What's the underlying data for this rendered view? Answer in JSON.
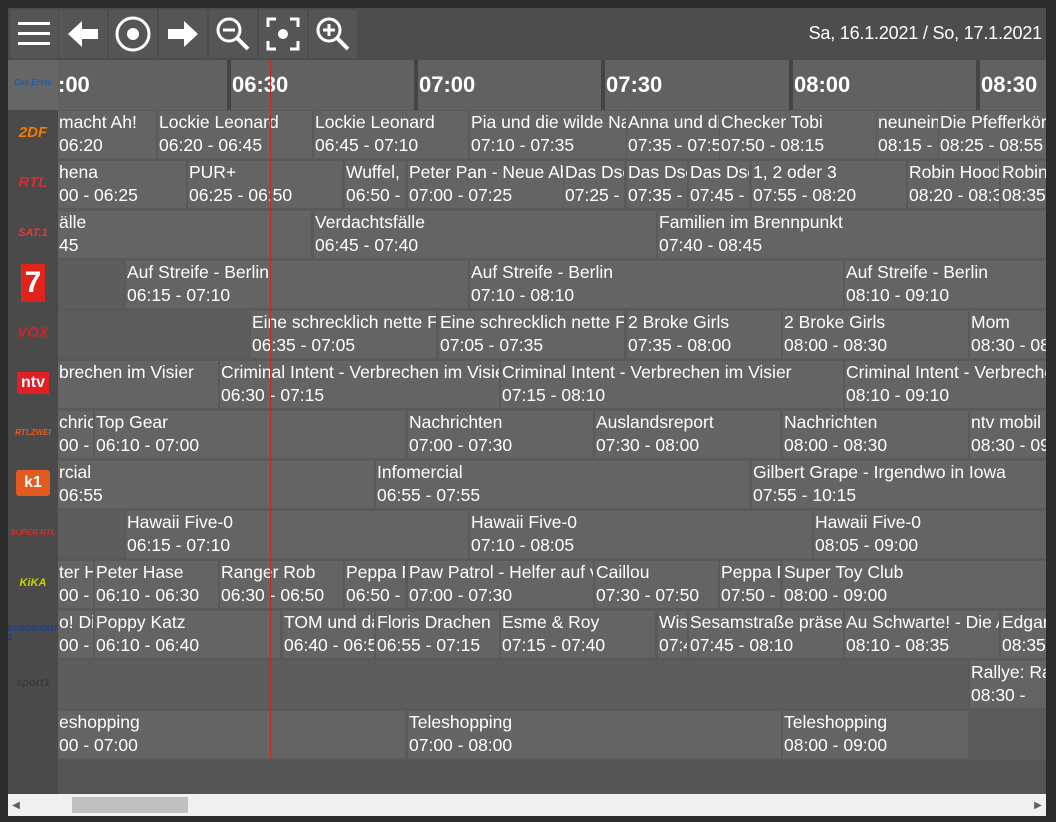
{
  "toolbar": {
    "menu_icon": "hamburger-icon",
    "back_icon": "arrow-left-icon",
    "now_icon": "target-icon",
    "forward_icon": "arrow-right-icon",
    "zoom_out_icon": "zoom-out-icon",
    "focus_icon": "focus-icon",
    "zoom_in_icon": "zoom-in-icon",
    "date_range": "Sa, 16.1.2021 / So, 17.1.2021"
  },
  "ruler": {
    "ticks": [
      ":00",
      "06:30",
      "07:00",
      "07:30",
      "08:00",
      "08:30"
    ]
  },
  "channels": [
    {
      "name": "Das Erste",
      "logo_text": "Das Erste",
      "color": "#1a5fa8",
      "programs": [
        {
          "title": " macht Ah!",
          "time": "06:20"
        },
        {
          "title": "Lockie Leonard",
          "time": "06:20 - 06:45"
        },
        {
          "title": "Lockie Leonard",
          "time": "06:45 - 07:10"
        },
        {
          "title": "Pia und die wilde Natur",
          "time": "07:10 - 07:35"
        },
        {
          "title": "Anna und die",
          "time": "07:35 - 07:50"
        },
        {
          "title": "Checker Tobi",
          "time": "07:50 - 08:15"
        },
        {
          "title": "neuneinhalb",
          "time": "08:15 - 08:25"
        },
        {
          "title": "Die Pfefferkörner",
          "time": "08:25 - 08:55"
        }
      ]
    },
    {
      "name": "ZDF",
      "logo_text": "2DF",
      "color": "#f07d00",
      "programs": [
        {
          "title": "hena",
          "time": "00 - 06:25"
        },
        {
          "title": "PUR+",
          "time": "06:25 - 06:50"
        },
        {
          "title": "Wuffel, d",
          "time": "06:50 - 07:00"
        },
        {
          "title": "Peter Pan - Neue Abenteuer",
          "time": "07:00 - 07:25"
        },
        {
          "title": "Das Dschungelbuch",
          "time": "07:25 - 07:35"
        },
        {
          "title": "Das Dschungelbuch",
          "time": "07:35 - 07:45"
        },
        {
          "title": "Das Dschungelbuch",
          "time": "07:45 - 07:55"
        },
        {
          "title": "1, 2 oder 3",
          "time": "07:55 - 08:20"
        },
        {
          "title": "Robin Hood",
          "time": "08:20 - 08:35"
        },
        {
          "title": "Robin Hood",
          "time": "08:35"
        }
      ]
    },
    {
      "name": "RTL",
      "logo_text": "RTL",
      "color": "#d32f2f",
      "programs": [
        {
          "title": "älle",
          "time": "45"
        },
        {
          "title": "Verdachtsfälle",
          "time": "06:45 - 07:40"
        },
        {
          "title": "Familien im Brennpunkt",
          "time": "07:40 - 08:45"
        }
      ]
    },
    {
      "name": "SAT.1",
      "logo_text": "SAT.1",
      "color": "#e53935",
      "programs": [
        {
          "title": "",
          "time": ""
        },
        {
          "title": "Auf Streife - Berlin",
          "time": "06:15 - 07:10"
        },
        {
          "title": "Auf Streife - Berlin",
          "time": "07:10 - 08:10"
        },
        {
          "title": "Auf Streife - Berlin",
          "time": "08:10 - 09:10"
        }
      ]
    },
    {
      "name": "ProSieben",
      "logo_text": "7",
      "color": "#e0241b",
      "programs": [
        {
          "title": "",
          "time": ""
        },
        {
          "title": "Eine schrecklich nette Familie",
          "time": "06:35 - 07:05"
        },
        {
          "title": "Eine schrecklich nette Familie",
          "time": "07:05 - 07:35"
        },
        {
          "title": "2 Broke Girls",
          "time": "07:35 - 08:00"
        },
        {
          "title": "2 Broke Girls",
          "time": "08:00 - 08:30"
        },
        {
          "title": "Mom",
          "time": "08:30 - 08"
        }
      ]
    },
    {
      "name": "VOX",
      "logo_text": "VOX",
      "color": "#c62828",
      "programs": [
        {
          "title": "brechen im Visier",
          "time": ""
        },
        {
          "title": "Criminal Intent - Verbrechen im Visier",
          "time": "06:30 - 07:15"
        },
        {
          "title": "Criminal Intent - Verbrechen im Visier",
          "time": "07:15 - 08:10"
        },
        {
          "title": "Criminal Intent - Verbrechen im Visier",
          "time": "08:10 - 09:10"
        }
      ]
    },
    {
      "name": "ntv",
      "logo_text": "ntv",
      "color": "#e31e24",
      "programs": [
        {
          "title": "chricht",
          "time": "00 - 06:10"
        },
        {
          "title": "Top Gear",
          "time": "06:10 - 07:00"
        },
        {
          "title": "Nachrichten",
          "time": "07:00 - 07:30"
        },
        {
          "title": "Auslandsreport",
          "time": "07:30 - 08:00"
        },
        {
          "title": "Nachrichten",
          "time": "08:00 - 08:30"
        },
        {
          "title": "ntv mobil",
          "time": "08:30 - 09"
        }
      ]
    },
    {
      "name": "RTLZWEI",
      "logo_text": "RTLZWEI",
      "color": "#e35a1f",
      "programs": [
        {
          "title": "rcial",
          "time": "06:55"
        },
        {
          "title": "Infomercial",
          "time": "06:55 - 07:55"
        },
        {
          "title": "Gilbert Grape - Irgendwo in Iowa",
          "time": "07:55 - 10:15"
        }
      ]
    },
    {
      "name": "kabel eins",
      "logo_text": "k1",
      "color": "#e35a1f",
      "programs": [
        {
          "title": "",
          "time": ""
        },
        {
          "title": "Hawaii Five-0",
          "time": "06:15 - 07:10"
        },
        {
          "title": "Hawaii Five-0",
          "time": "07:10 - 08:05"
        },
        {
          "title": "Hawaii Five-0",
          "time": "08:05 - 09:00"
        }
      ]
    },
    {
      "name": "Super RTL",
      "logo_text": "SUPER RTL",
      "color": "#d32f2f",
      "programs": [
        {
          "title": "ter Has",
          "time": "00 - 06:10"
        },
        {
          "title": "Peter Hase",
          "time": "06:10 - 06:30"
        },
        {
          "title": "Ranger Rob",
          "time": "06:30 - 06:50"
        },
        {
          "title": "Peppa Pig",
          "time": "06:50 - 07:00"
        },
        {
          "title": "Paw Patrol - Helfer auf vier Pfoten",
          "time": "07:00 - 07:30"
        },
        {
          "title": "Caillou",
          "time": "07:30 - 07:50"
        },
        {
          "title": "Peppa Pig",
          "time": "07:50 - 08:00"
        },
        {
          "title": "Super Toy Club",
          "time": "08:00 - 09:00"
        }
      ]
    },
    {
      "name": "KiKA",
      "logo_text": "KiKA",
      "color": "#c6d400",
      "programs": [
        {
          "title": "o! Die",
          "time": "00 - 06:10"
        },
        {
          "title": "Poppy Katz",
          "time": "06:10 - 06:40"
        },
        {
          "title": "TOM und das",
          "time": "06:40 - 06:55"
        },
        {
          "title": "Floris Drachen",
          "time": "06:55 - 07:15"
        },
        {
          "title": "Esme & Roy",
          "time": "07:15 - 07:40"
        },
        {
          "title": "Wissen",
          "time": "07:40"
        },
        {
          "title": "Sesamstraße präsentiert",
          "time": "07:45 - 08:10"
        },
        {
          "title": "Au Schwarte! - Die Abenteuer",
          "time": "08:10 - 08:35"
        },
        {
          "title": "Edgar",
          "time": "08:35"
        }
      ]
    },
    {
      "name": "Eurosport 1",
      "logo_text": "EUROSPORT 1",
      "color": "#1c3f8c",
      "programs": [
        {
          "title": "",
          "time": ""
        },
        {
          "title": "Rallye: Ra",
          "time": "08:30 - "
        }
      ]
    },
    {
      "name": "Sport1",
      "logo_text": "sport1",
      "color": "#3a3a3a",
      "programs": [
        {
          "title": "eshopping",
          "time": "00 - 07:00"
        },
        {
          "title": "Teleshopping",
          "time": "07:00 - 08:00"
        },
        {
          "title": "Teleshopping",
          "time": "08:00 - 09:00"
        }
      ]
    }
  ],
  "scrollbar": {
    "left_arrow": "◀",
    "right_arrow": "▶"
  }
}
